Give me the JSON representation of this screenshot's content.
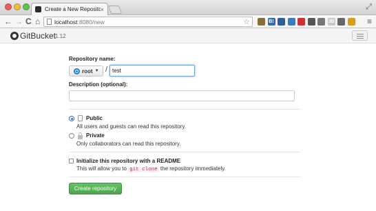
{
  "browser": {
    "tab_title": "Create a New Repository",
    "tab_close": "×",
    "url_host": "localhost",
    "url_rest": ":8080/new",
    "back": "←",
    "forward": "→",
    "reload": "C",
    "home": "⌂",
    "star": "☆",
    "menu": "≡",
    "extensions": [
      {
        "name": "extension-1-icon",
        "label": "",
        "color": "#8a6d3b"
      },
      {
        "name": "extension-b-icon",
        "label": "B!",
        "color": "#2a6ebb"
      },
      {
        "name": "extension-3-icon",
        "label": "",
        "color": "#2f5c9a"
      },
      {
        "name": "extension-4-icon",
        "label": "",
        "color": "#3b7bc0"
      },
      {
        "name": "extension-mail-icon",
        "label": "",
        "color": "#cc3333"
      },
      {
        "name": "extension-gear-icon",
        "label": "",
        "color": "#555555"
      },
      {
        "name": "extension-scroll-icon",
        "label": "",
        "color": "#777777"
      },
      {
        "name": "extension-jb-icon",
        "label": "JB",
        "color": "#c8c8c8"
      },
      {
        "name": "extension-gear2-icon",
        "label": "",
        "color": "#666666"
      },
      {
        "name": "extension-badge-icon",
        "label": "",
        "color": "#d4a017"
      }
    ]
  },
  "header": {
    "brand": "GitBucket",
    "version": "1.12"
  },
  "form": {
    "repo_name_label": "Repository name:",
    "owner": "root",
    "owner_caret": "▼",
    "separator": "/",
    "repo_name_value": "test",
    "description_label": "Description (optional):",
    "description_value": "",
    "public_title": "Public",
    "public_desc": "All users and guests can read this repository.",
    "private_title": "Private",
    "private_desc": "Only collaborators can read this repository.",
    "readme_title": "Initialize this repository with a README",
    "readme_desc_before": "This will allow you to",
    "readme_desc_code": "git clone",
    "readme_desc_after": "the repository immediately.",
    "create_button": "Create repository"
  }
}
